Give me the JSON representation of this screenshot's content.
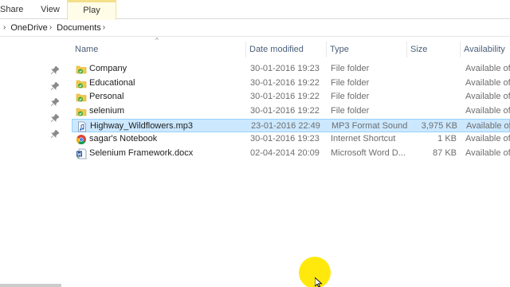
{
  "ribbon": {
    "tabs": [
      {
        "label": "Share"
      },
      {
        "label": "View"
      },
      {
        "label": "Play"
      }
    ],
    "contextual_tab_color": "#f5e08a"
  },
  "address": {
    "segments": [
      "OneDrive",
      "Documents"
    ]
  },
  "columns": {
    "name": "Name",
    "date": "Date modified",
    "type": "Type",
    "size": "Size",
    "availability": "Availability"
  },
  "files": [
    {
      "name": "Company",
      "date": "30-01-2016 19:23",
      "type": "File folder",
      "size": "",
      "availability": "Available offline",
      "icon": "folder-synced-icon"
    },
    {
      "name": "Educational",
      "date": "30-01-2016 19:22",
      "type": "File folder",
      "size": "",
      "availability": "Available offline",
      "icon": "folder-synced-icon"
    },
    {
      "name": "Personal",
      "date": "30-01-2016 19:22",
      "type": "File folder",
      "size": "",
      "availability": "Available offline",
      "icon": "folder-synced-icon"
    },
    {
      "name": "selenium",
      "date": "30-01-2016 19:22",
      "type": "File folder",
      "size": "",
      "availability": "Available offline",
      "icon": "folder-synced-icon"
    },
    {
      "name": "Highway_Wildflowers.mp3",
      "date": "23-01-2016 22:49",
      "type": "MP3 Format Sound",
      "size": "3,975 KB",
      "availability": "Available offline",
      "icon": "audio-file-icon",
      "selected": true
    },
    {
      "name": "sagar's Notebook",
      "date": "30-01-2016 19:23",
      "type": "Internet Shortcut",
      "size": "1 KB",
      "availability": "Available offline",
      "icon": "chrome-shortcut-icon"
    },
    {
      "name": "Selenium Framework.docx",
      "date": "02-04-2014 20:09",
      "type": "Microsoft Word D...",
      "size": "87 KB",
      "availability": "Available offline",
      "icon": "word-document-icon"
    }
  ],
  "colors": {
    "selection": "#cce8ff",
    "selection_border": "#99d1ff",
    "folder": "#f3c94c",
    "sync_check": "#3cab3c",
    "header_text": "#4c607a",
    "cursor_highlight": "#ffe800"
  }
}
